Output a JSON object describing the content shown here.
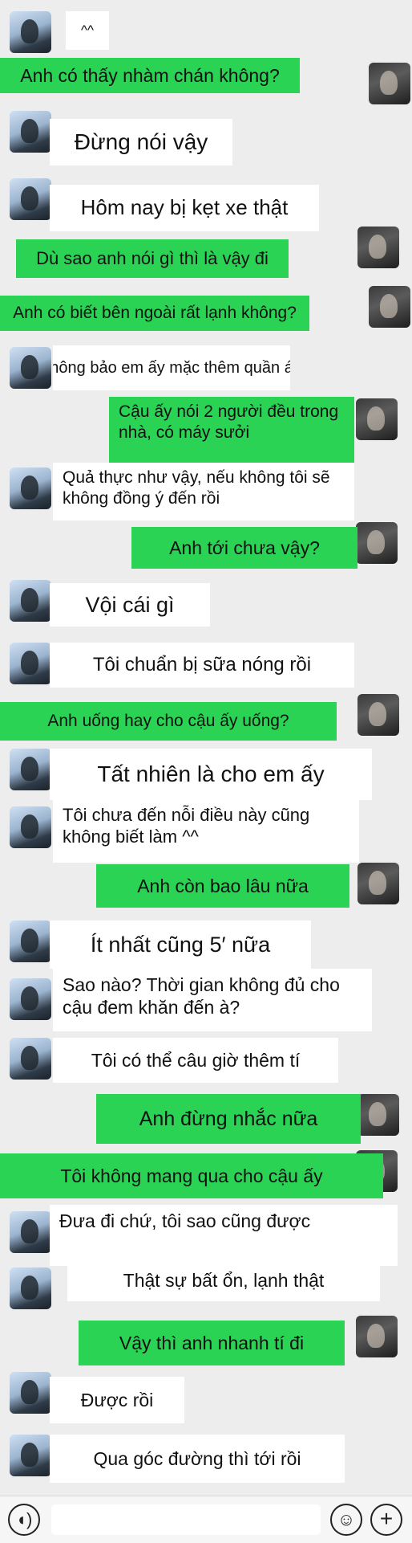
{
  "messages": [
    {
      "side": "in",
      "text": "^^"
    },
    {
      "side": "out",
      "text": "Anh có thấy nhàm chán không?"
    },
    {
      "side": "in",
      "text": "Đừng nói vậy"
    },
    {
      "side": "in",
      "text": "Hôm nay bị kẹt xe thật"
    },
    {
      "side": "out",
      "text": "Dù sao anh nói gì thì là vậy đi"
    },
    {
      "side": "out",
      "text": "Anh có biết bên ngoài rất lạnh không?"
    },
    {
      "side": "in",
      "text": "Cậu không bảo em ấy mặc thêm quần áo à ^^"
    },
    {
      "side": "out",
      "text": "Cậu ấy nói 2 người đều trong nhà, có máy sưởi"
    },
    {
      "side": "in",
      "text": "Quả thực như vậy, nếu không tôi sẽ không đồng ý đến rồi"
    },
    {
      "side": "out",
      "text": "Anh tới chưa vậy?"
    },
    {
      "side": "in",
      "text": "Vội cái gì"
    },
    {
      "side": "in",
      "text": "Tôi chuẩn bị sữa nóng rồi"
    },
    {
      "side": "out",
      "text": "Anh uống hay cho cậu ấy uống?"
    },
    {
      "side": "in",
      "text": "Tất nhiên là cho em ấy"
    },
    {
      "side": "in",
      "text": "Tôi chưa đến nỗi điều này cũng không biết làm ^^"
    },
    {
      "side": "out",
      "text": "Anh còn bao lâu nữa"
    },
    {
      "side": "in",
      "text": "Ít nhất cũng 5′ nữa"
    },
    {
      "side": "in",
      "text": "Sao nào? Thời gian không đủ cho cậu đem khăn đến à?"
    },
    {
      "side": "in",
      "text": "Tôi có thể câu giờ thêm tí"
    },
    {
      "side": "out",
      "text": "Anh đừng nhắc nữa"
    },
    {
      "side": "out",
      "text": "Tôi không mang qua cho cậu ấy"
    },
    {
      "side": "in",
      "text": "Đưa đi chứ, tôi sao cũng được"
    },
    {
      "side": "in",
      "text": "Thật sự bất ổn, lạnh thật"
    },
    {
      "side": "out",
      "text": "Vậy thì anh nhanh tí đi"
    },
    {
      "side": "in",
      "text": "Được rồi"
    },
    {
      "side": "in",
      "text": "Qua góc đường thì tới rồi"
    }
  ],
  "input_bar": {
    "voice_icon": "voice-icon",
    "emoji_icon": "emoji-icon",
    "plus_icon": "plus-icon",
    "colors": {
      "bg": "#f6f6f6",
      "outgoing": "#2bd355",
      "incoming": "#ffffff"
    }
  }
}
